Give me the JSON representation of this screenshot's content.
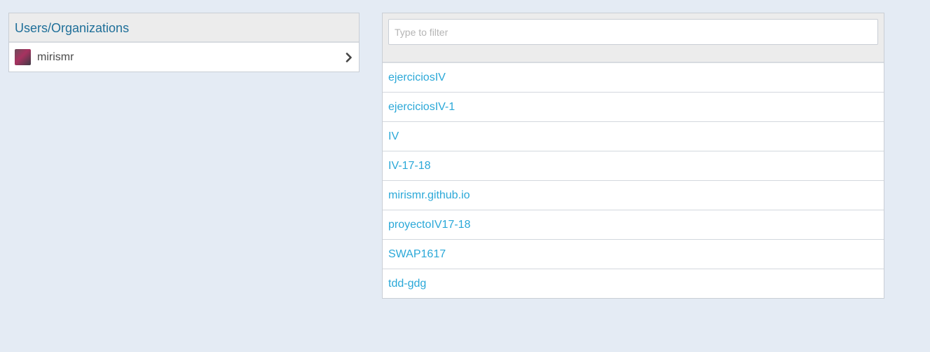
{
  "users_panel": {
    "title": "Users/Organizations",
    "users": [
      {
        "name": "mirismr",
        "avatar_icon": "user-avatar",
        "chevron_icon": "chevron-right-icon"
      }
    ]
  },
  "repos_panel": {
    "filter": {
      "placeholder": "Type to filter",
      "value": ""
    },
    "repos": [
      {
        "name": "ejerciciosIV"
      },
      {
        "name": "ejerciciosIV-1"
      },
      {
        "name": "IV"
      },
      {
        "name": "IV-17-18"
      },
      {
        "name": "mirismr.github.io"
      },
      {
        "name": "proyectoIV17-18"
      },
      {
        "name": "SWAP1617"
      },
      {
        "name": "tdd-gdg"
      }
    ]
  },
  "colors": {
    "background": "#e4ebf4",
    "heading_text": "#1f6f99",
    "link": "#2aa8d8"
  }
}
